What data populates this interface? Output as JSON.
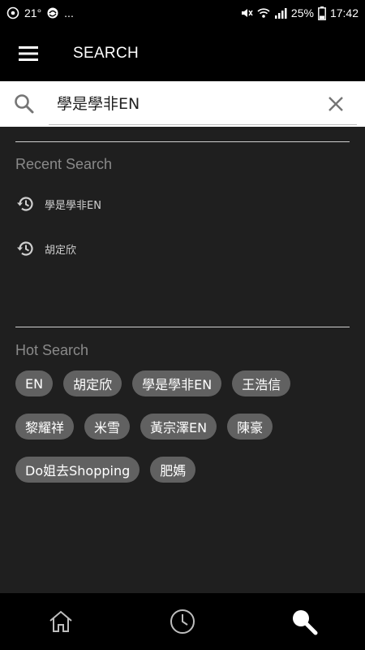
{
  "status_bar": {
    "temperature": "21°",
    "ellipsis": "...",
    "battery_percent": "25%",
    "time": "17:42"
  },
  "app_bar": {
    "title": "SEARCH"
  },
  "search": {
    "value": "學是學非EN"
  },
  "recent": {
    "title": "Recent Search",
    "items": [
      {
        "label": "學是學非EN",
        "icon": "history-icon"
      },
      {
        "label": "胡定欣",
        "icon": "history-icon"
      }
    ]
  },
  "hot": {
    "title": "Hot Search",
    "rows": [
      [
        "EN",
        "胡定欣",
        "學是學非EN",
        "王浩信"
      ],
      [
        "黎耀祥",
        "米雪",
        "黃宗澤EN",
        "陳豪"
      ],
      [
        "Do姐去Shopping",
        "肥媽"
      ]
    ]
  },
  "bottom_nav": [
    {
      "name": "home",
      "icon": "home-icon",
      "active": false
    },
    {
      "name": "history",
      "icon": "clock-icon",
      "active": false
    },
    {
      "name": "search",
      "icon": "search-icon",
      "active": true
    }
  ],
  "colors": {
    "background": "#1f1f1f",
    "bars": "#000000",
    "chip": "#616161",
    "muted_text": "#8a8a8a"
  }
}
